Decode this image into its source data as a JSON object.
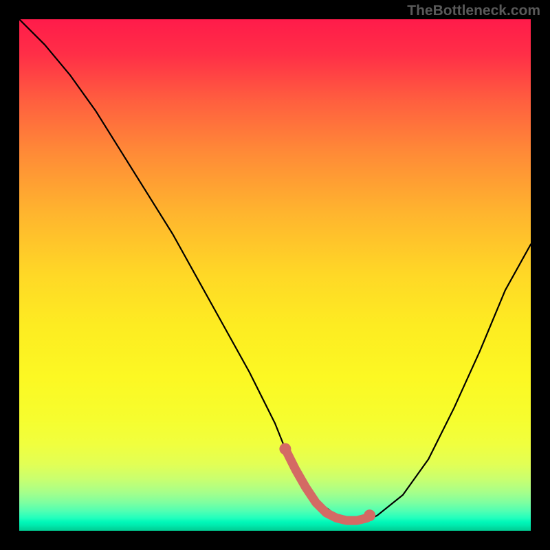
{
  "watermark": "TheBottleneck.com",
  "chart_data": {
    "type": "line",
    "title": "",
    "xlabel": "",
    "ylabel": "",
    "xlim": [
      0,
      100
    ],
    "ylim": [
      0,
      100
    ],
    "series": [
      {
        "name": "curve",
        "color": "#000000",
        "x": [
          0,
          5,
          10,
          15,
          20,
          25,
          30,
          35,
          40,
          45,
          50,
          52,
          55,
          58,
          62,
          66,
          68,
          70,
          75,
          80,
          85,
          90,
          95,
          100
        ],
        "y": [
          100,
          95,
          89,
          82,
          74,
          66,
          58,
          49,
          40,
          31,
          21,
          16,
          10,
          6,
          3,
          2,
          2,
          3,
          7,
          14,
          24,
          35,
          47,
          56
        ]
      },
      {
        "name": "highlight",
        "color": "#d46a64",
        "x": [
          52,
          54,
          56,
          58,
          60,
          62,
          64,
          66,
          68
        ],
        "y": [
          16,
          12,
          8.5,
          5.5,
          3.5,
          2.5,
          2,
          2,
          2.5
        ]
      }
    ],
    "highlight_dots": {
      "color": "#d46a64",
      "points": [
        {
          "x": 52,
          "y": 16
        },
        {
          "x": 68.5,
          "y": 3
        }
      ]
    }
  }
}
